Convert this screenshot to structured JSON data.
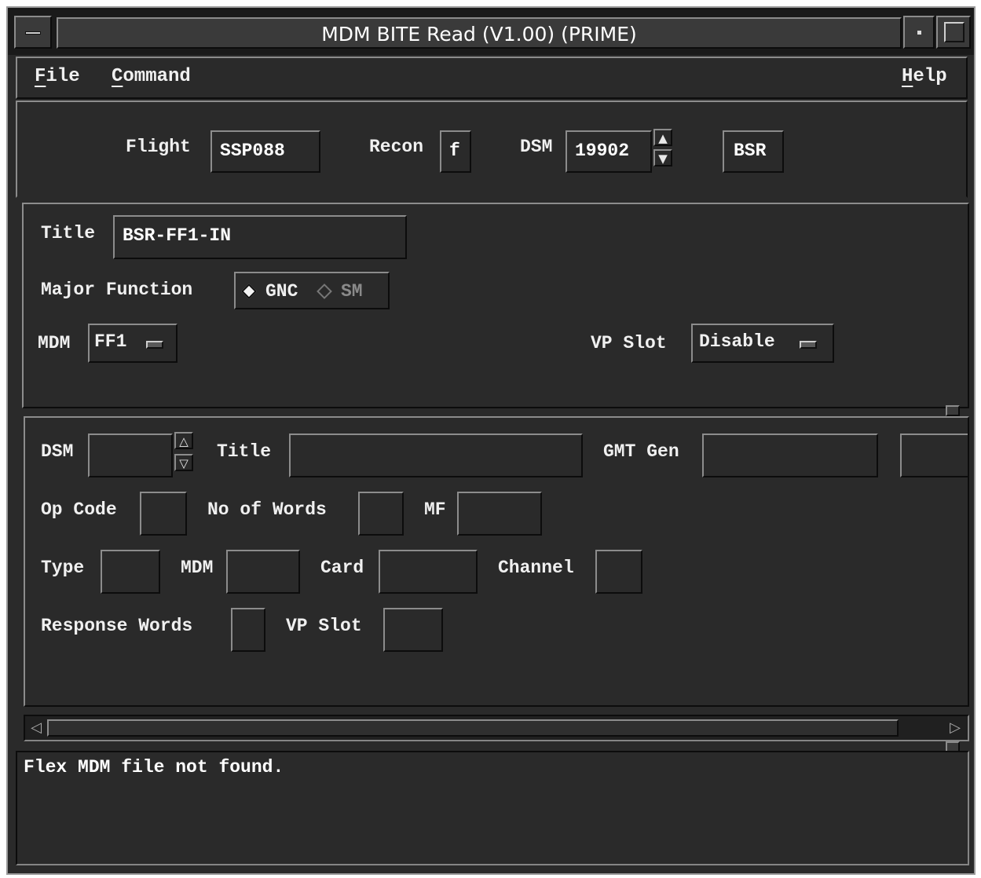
{
  "window": {
    "title": "MDM BITE Read (V1.00) (PRIME)"
  },
  "menubar": {
    "file": {
      "mnemonic": "F",
      "rest": "ile"
    },
    "command": {
      "mnemonic": "C",
      "rest": "ommand"
    },
    "help": {
      "mnemonic": "H",
      "rest": "elp"
    }
  },
  "header": {
    "flight_label": "Flight",
    "flight_value": "SSP088",
    "recon_label": "Recon",
    "recon_value": "f",
    "dsm_label": "DSM",
    "dsm_value": "19902",
    "bsr_button": "BSR"
  },
  "selection": {
    "title_label": "Title",
    "title_value": "BSR-FF1-IN",
    "major_function_label": "Major Function",
    "gnc_label": "GNC",
    "sm_label": "SM",
    "major_function_selected": "GNC",
    "mdm_label": "MDM",
    "mdm_value": "FF1",
    "vp_slot_label": "VP Slot",
    "vp_slot_value": "Disable"
  },
  "details": {
    "dsm_label": "DSM",
    "dsm_value": "",
    "title_label": "Title",
    "title_value": "",
    "gmt_gen_label": "GMT Gen",
    "gmt_gen_value": "",
    "gmt_gen_extra_value": "",
    "op_code_label": "Op Code",
    "op_code_value": "",
    "no_of_words_label": "No of Words",
    "no_of_words_value": "",
    "mf_label": "MF",
    "mf_value": "",
    "type_label": "Type",
    "type_value": "",
    "mdm_label": "MDM",
    "mdm_value": "",
    "card_label": "Card",
    "card_value": "",
    "channel_label": "Channel",
    "channel_value": "",
    "response_words_label": "Response Words",
    "response_words_value": "",
    "vp_slot_label": "VP Slot",
    "vp_slot_value": ""
  },
  "messages": {
    "text": "Flex MDM file not found."
  },
  "icons": {
    "up_arrow": "up-arrow-icon",
    "down_arrow": "down-arrow-icon",
    "left_arrow": "left-arrow-icon",
    "right_arrow": "right-arrow-icon",
    "window_menu": "window-menu-icon",
    "minimize": "minimize-icon",
    "maximize": "maximize-icon",
    "option_menu": "option-menu-indicator-icon"
  }
}
